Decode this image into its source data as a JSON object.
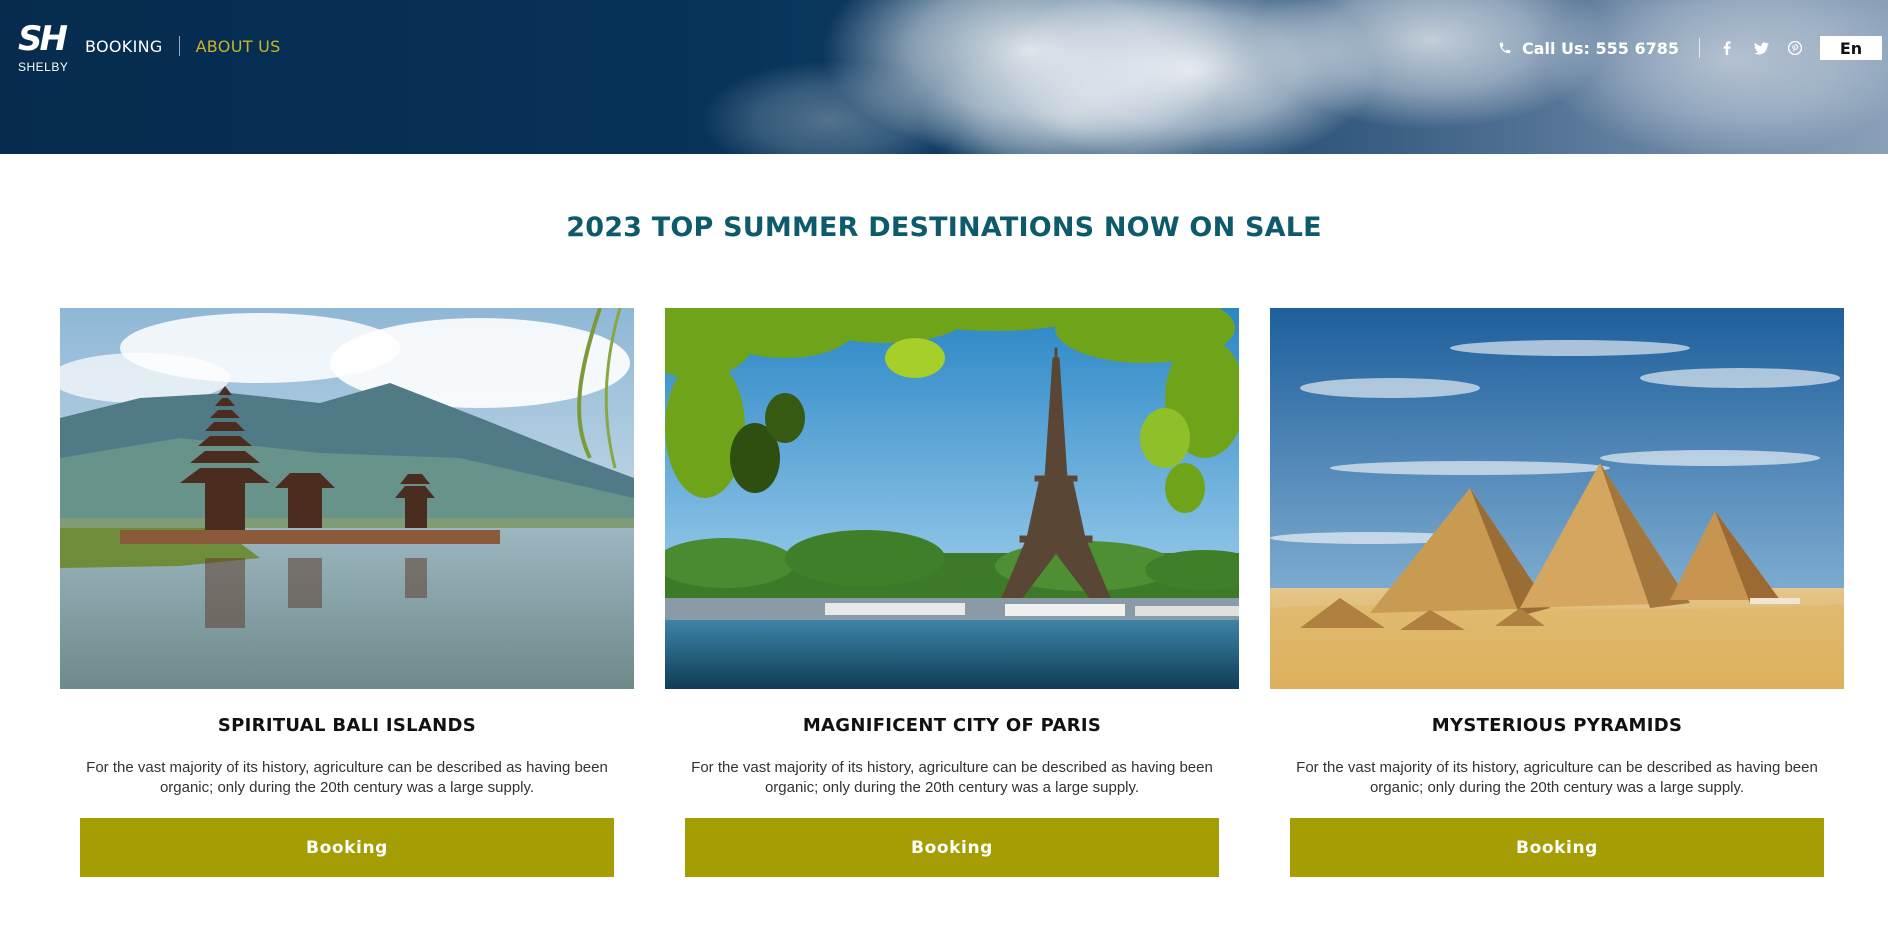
{
  "header": {
    "logo_mark": "SH",
    "logo_name": "SHELBY",
    "nav": {
      "booking": "BOOKING",
      "about": "ABOUT US"
    },
    "phone": "Call Us: 555 6785",
    "language": "En",
    "icons": [
      "phone-icon",
      "facebook-icon",
      "twitter-icon",
      "pinterest-icon"
    ],
    "colors": {
      "header_bg": "#073258",
      "active_nav": "#c9b52a"
    }
  },
  "main": {
    "title": "2023 TOP SUMMER DESTINATIONS NOW ON SALE",
    "cards": [
      {
        "title": "SPIRITUAL BALI ISLANDS",
        "description": "For the vast majority of its history, agriculture can be described as having been organic; only during the 20th century was a large supply.",
        "button": "Booking"
      },
      {
        "title": "MAGNIFICENT CITY OF PARIS",
        "description": "For the vast majority of its history, agriculture can be described as having been organic; only during the 20th century was a large supply.",
        "button": "Booking"
      },
      {
        "title": "MYSTERIOUS PYRAMIDS",
        "description": "For the vast majority of its history, agriculture can be described as having been organic; only during the 20th century was a large supply.",
        "button": "Booking"
      }
    ],
    "colors": {
      "title": "#0d5a6c",
      "button": "#a59d04"
    }
  }
}
